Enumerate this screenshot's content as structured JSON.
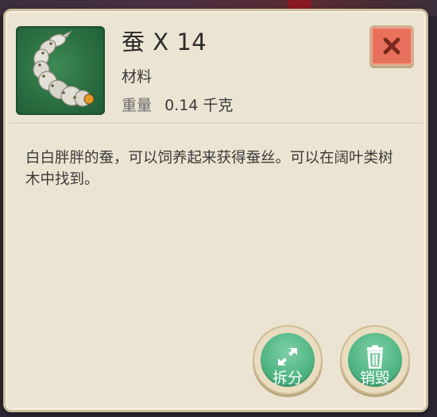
{
  "item": {
    "name": "蚕",
    "quantity_text": "X 14",
    "category": "材料",
    "weight_label": "重量",
    "weight_value": "0.14 千克",
    "icon": "silkworm-icon",
    "description": "白白胖胖的蚕，可以饲养起来获得蚕丝。可以在阔叶类树木中找到。"
  },
  "actions": {
    "close_icon": "close-icon",
    "split_label": "拆分",
    "split_icon": "expand-arrows-icon",
    "destroy_label": "销毁",
    "destroy_icon": "trash-icon"
  },
  "colors": {
    "panel_bg": "#ece4d2",
    "panel_border": "#cdbf9e",
    "close_button": "#e8715c",
    "action_button": "#4fb482",
    "icon_bg": "#2a6e40"
  }
}
